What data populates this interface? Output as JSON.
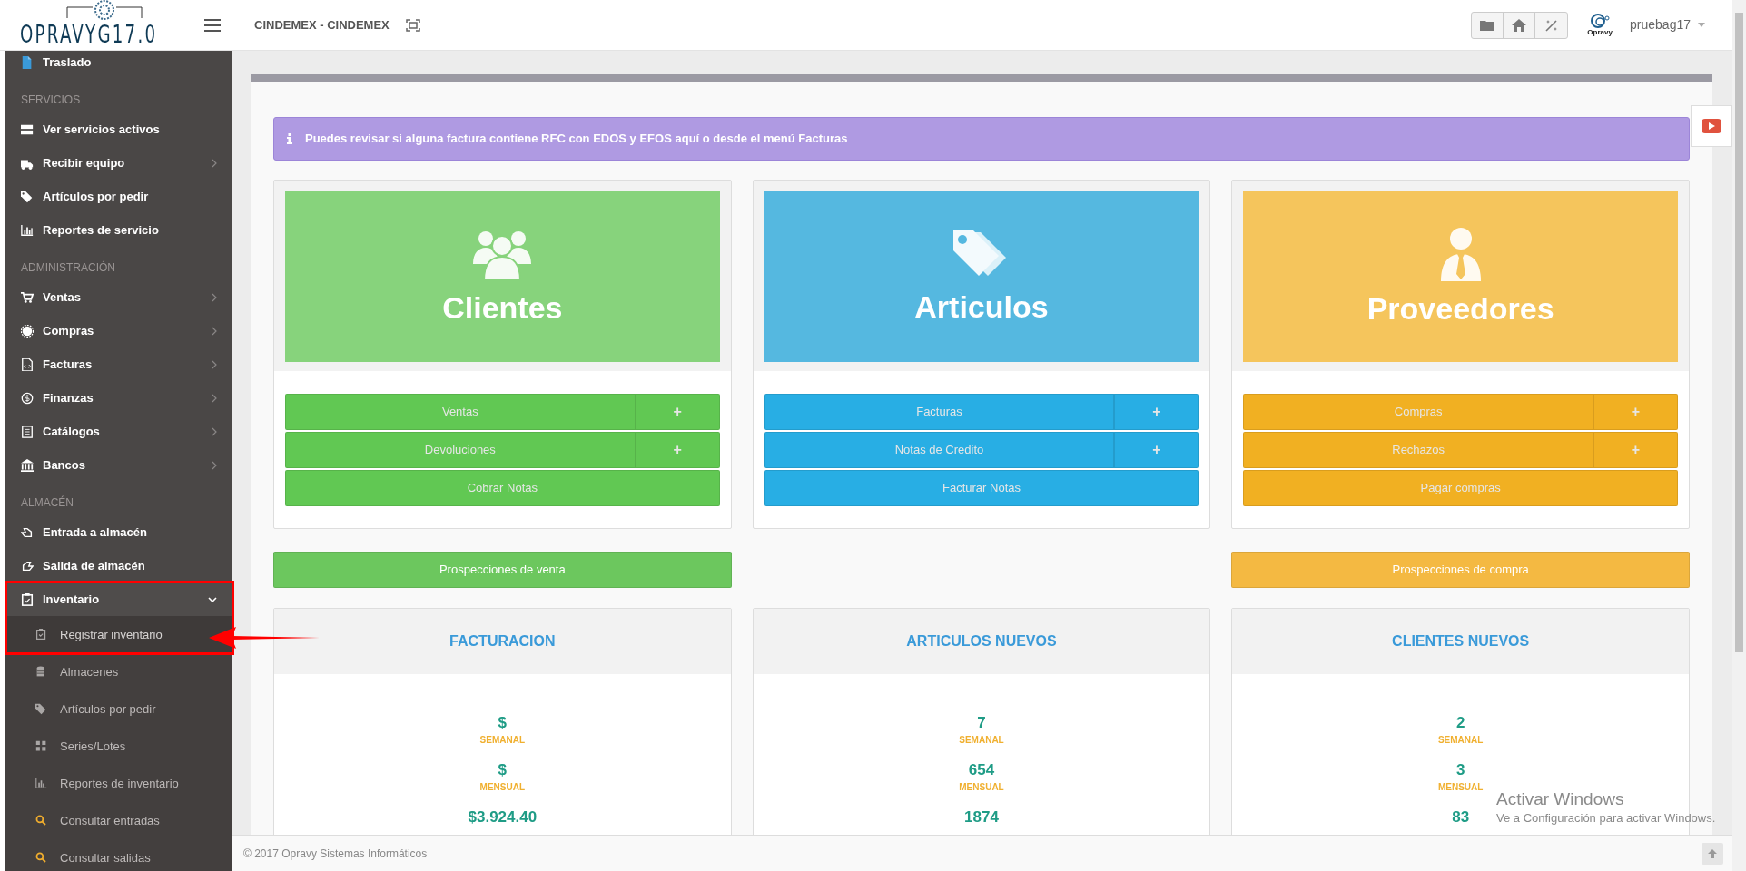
{
  "header": {
    "logo": "OPRAVYG17.0",
    "company": "CINDEMEX - CINDEMEX",
    "brand_caption": "Opravy",
    "user": "pruebag17"
  },
  "sidebar": {
    "sections": [
      {
        "items": [
          {
            "label": "Traslado",
            "submenu": false
          }
        ]
      },
      {
        "title": "SERVICIOS",
        "items": [
          {
            "label": "Ver servicios activos",
            "submenu": false
          },
          {
            "label": "Recibir equipo",
            "submenu": true,
            "expanded": false
          },
          {
            "label": "Artículos por pedir",
            "submenu": false
          },
          {
            "label": "Reportes de servicio",
            "submenu": false
          }
        ]
      },
      {
        "title": "ADMINISTRACIÓN",
        "items": [
          {
            "label": "Ventas",
            "submenu": true,
            "expanded": false
          },
          {
            "label": "Compras",
            "submenu": true,
            "expanded": false
          },
          {
            "label": "Facturas",
            "submenu": true,
            "expanded": false
          },
          {
            "label": "Finanzas",
            "submenu": true,
            "expanded": false
          },
          {
            "label": "Catálogos",
            "submenu": true,
            "expanded": false
          },
          {
            "label": "Bancos",
            "submenu": true,
            "expanded": false
          }
        ]
      },
      {
        "title": "ALMACÉN",
        "items": [
          {
            "label": "Entrada a almacén",
            "submenu": false
          },
          {
            "label": "Salida de almacén",
            "submenu": false
          },
          {
            "label": "Inventario",
            "submenu": true,
            "expanded": true,
            "children": [
              {
                "label": "Registrar inventario",
                "selected": true
              },
              {
                "label": "Almacenes",
                "selected": false
              },
              {
                "label": "Artículos por pedir",
                "selected": false
              },
              {
                "label": "Series/Lotes",
                "selected": false
              },
              {
                "label": "Reportes de inventario",
                "selected": false
              },
              {
                "label": "Consultar entradas",
                "selected": false
              },
              {
                "label": "Consultar salidas",
                "selected": false
              }
            ]
          }
        ]
      }
    ]
  },
  "alert": "Puedes revisar si alguna factura contiene RFC con EDOS y EFOS aquí o desde el menú Facturas",
  "cards": [
    {
      "title": "Clientes",
      "color": "#87d37c",
      "buttons": [
        {
          "label": "Ventas",
          "extra": "+"
        },
        {
          "label": "Devoluciones",
          "extra": "+"
        },
        {
          "label": "Cobrar Notas"
        }
      ]
    },
    {
      "title": "Articulos",
      "color": "#55b8e0",
      "buttons": [
        {
          "label": "Facturas",
          "extra": "+"
        },
        {
          "label": "Notas de Credito",
          "extra": "+"
        },
        {
          "label": "Facturar Notas"
        }
      ]
    },
    {
      "title": "Proveedores",
      "color": "#f5c55c",
      "buttons": [
        {
          "label": "Compras",
          "extra": "+"
        },
        {
          "label": "Rechazos",
          "extra": "+"
        },
        {
          "label": "Pagar compras"
        }
      ]
    }
  ],
  "prospecciones": [
    {
      "label": "Prospecciones de venta",
      "color": "#6cc75e"
    },
    {
      "label": "Prospecciones de compra",
      "color": "#f4b942"
    }
  ],
  "stats": [
    {
      "title": "FACTURACION",
      "rows": [
        {
          "value": "$",
          "label": "SEMANAL"
        },
        {
          "value": "$",
          "label": "MENSUAL"
        },
        {
          "value": "$3.924.40"
        }
      ]
    },
    {
      "title": "ARTICULOS NUEVOS",
      "rows": [
        {
          "value": "7",
          "label": "SEMANAL"
        },
        {
          "value": "654",
          "label": "MENSUAL"
        },
        {
          "value": "1874"
        }
      ]
    },
    {
      "title": "CLIENTES NUEVOS",
      "rows": [
        {
          "value": "2",
          "label": "SEMANAL"
        },
        {
          "value": "3",
          "label": "MENSUAL"
        },
        {
          "value": "83"
        }
      ]
    }
  ],
  "footer": "© 2017 Opravy Sistemas Informáticos",
  "os_notice": {
    "title": "Activar Windows",
    "text": "Ve a Configuración para activar Windows."
  }
}
